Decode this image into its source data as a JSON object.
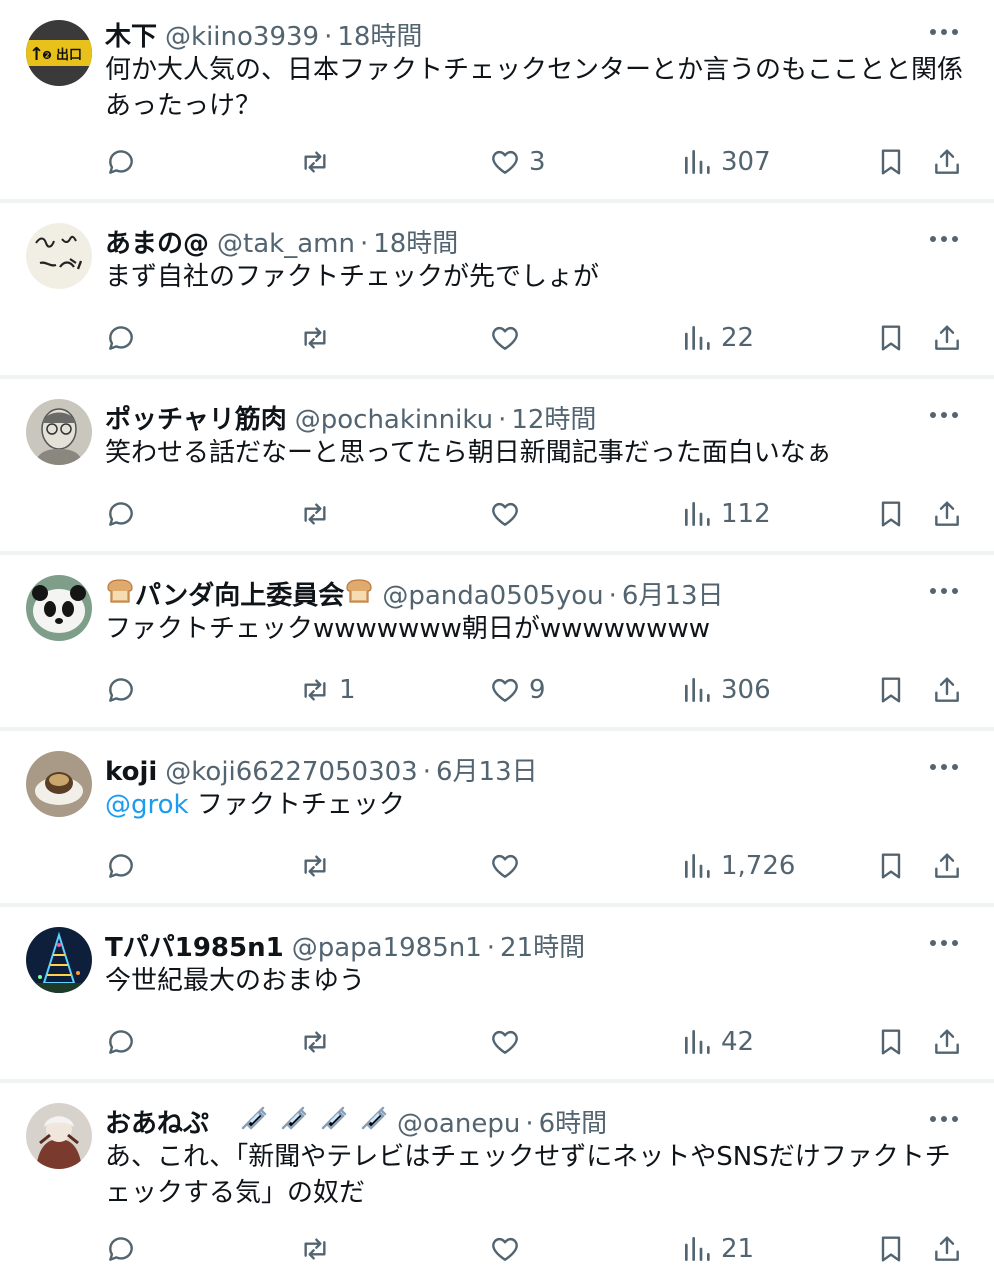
{
  "posts": [
    {
      "name": "木下",
      "handle": "@kiino3939",
      "time": "18時間",
      "text": "何か大人気の、日本ファクトチェックセンターとか言うのもこことと関係あったっけ？",
      "reply_count": "",
      "repost_count": "",
      "like_count": "3",
      "view_count": "307",
      "avatar_text": "出口",
      "avatar_badge": "❷"
    },
    {
      "name": "あまの@",
      "handle": "@tak_amn",
      "time": "18時間",
      "text": "まず自社のファクトチェックが先でしょが",
      "reply_count": "",
      "repost_count": "",
      "like_count": "",
      "view_count": "22"
    },
    {
      "name": "ポッチャリ筋肉",
      "handle": "@pochakinniku",
      "time": "12時間",
      "text": "笑わせる話だなーと思ってたら朝日新聞記事だった面白いなぁ",
      "reply_count": "",
      "repost_count": "",
      "like_count": "",
      "view_count": "112"
    },
    {
      "name": "パンダ向上委員会",
      "handle": "@panda0505you",
      "time": "6月13日",
      "text": "ファクトチェックwwwwwww朝日がwwwwwwww",
      "reply_count": "",
      "repost_count": "1",
      "like_count": "9",
      "view_count": "306"
    },
    {
      "name": "koji",
      "handle": "@koji66227050303",
      "time": "6月13日",
      "mention": "@grok",
      "text": " ファクトチェック",
      "reply_count": "",
      "repost_count": "",
      "like_count": "",
      "view_count": "1,726"
    },
    {
      "name": "Tパパ1985n1",
      "handle": "@papa1985n1",
      "time": "21時間",
      "text": "今世紀最大のおまゆう",
      "reply_count": "",
      "repost_count": "",
      "like_count": "",
      "view_count": "42"
    },
    {
      "name": "おあねぷ",
      "handle": "@oanepu",
      "time": "6時間",
      "text": "あ、これ、「新聞やテレビはチェックせずにネットやSNSだけファクトチェックする気」の奴だ",
      "reply_count": "",
      "repost_count": "",
      "like_count": "",
      "view_count": "21"
    }
  ],
  "separator": "·",
  "colors": {
    "text": "#0f1419",
    "secondary": "#536471",
    "link": "#1d9bf0",
    "divider": "#eff3f4"
  },
  "icons": [
    "reply-icon",
    "repost-icon",
    "like-icon",
    "views-icon",
    "bookmark-icon",
    "share-icon",
    "more-icon",
    "bread-emoji",
    "syringe-emoji"
  ]
}
